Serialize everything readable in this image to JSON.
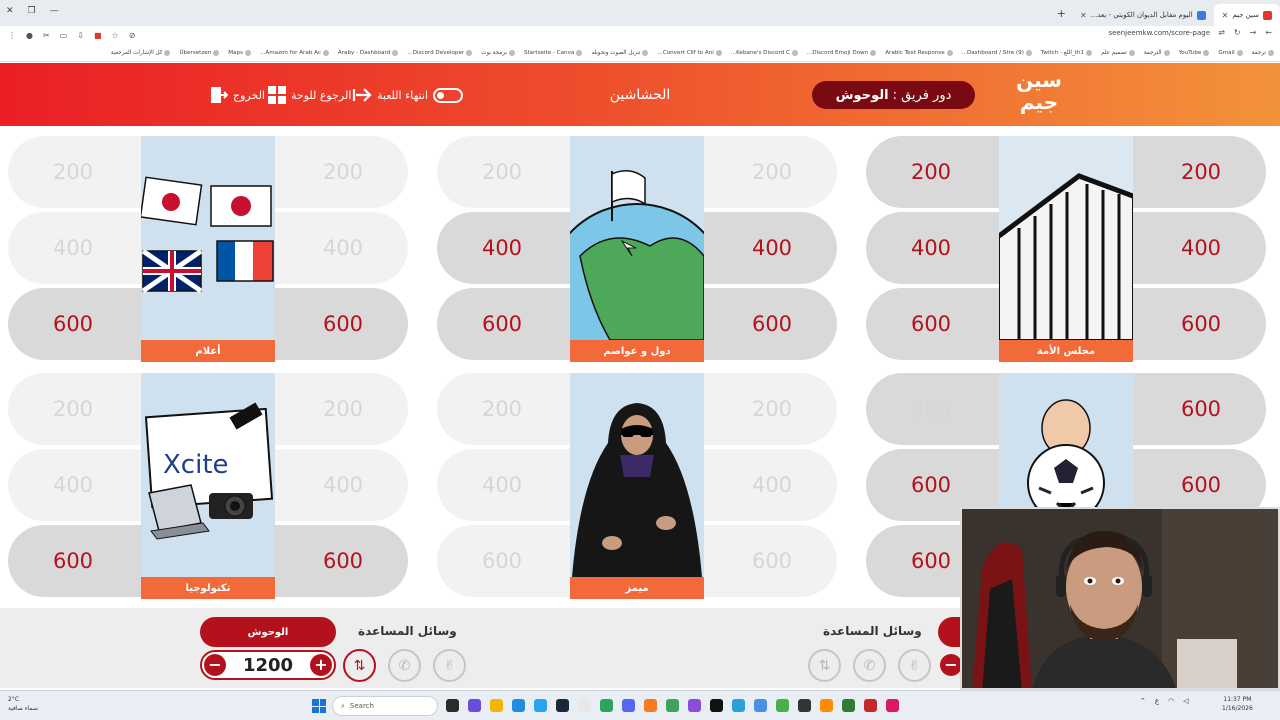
{
  "browser": {
    "tabs": [
      {
        "title": "سين جيم",
        "active": true
      },
      {
        "title": "اليوم مقابل الديوان الكويتي - بعد...",
        "active": false
      }
    ],
    "url": "seenjeemkw.com/score-page",
    "bookmarks": [
      "ترجمة",
      "Gmail",
      "YouTube",
      "الترجمة",
      "تصميم علم",
      "th1_اللغ - Twitch",
      "(9) Dashboard / Stre...",
      "Arabic Text Response",
      "Discord Emoji Down...",
      "Kebane's Discord C...",
      "Convert Clif to Ani...",
      "تنزيل الصوت وتحويله",
      "Startseite - Canva",
      "برمجة بوت",
      "Discord Developer...",
      "Araby - Dashboard",
      "Amazon for Arab Ac...",
      "Maps",
      "Übersetzen",
      "كل الإشارات المرجعية"
    ]
  },
  "header": {
    "logo_line1": "سين",
    "logo_line2": "جيم",
    "turn_prefix": "دور فريق :",
    "turn_team": "الوحوش",
    "game_name": "الحشاشين",
    "end_game": "انتهاء اللعبة",
    "back_to_board": "الرجوع للوحة",
    "exit": "الخروج"
  },
  "board": {
    "panels": [
      {
        "category": "مجلس الأمة",
        "art": "building",
        "left": [
          {
            "value": "200",
            "active": true
          },
          {
            "value": "400",
            "active": true
          },
          {
            "value": "600",
            "active": true
          }
        ],
        "right": [
          {
            "value": "200",
            "active": true
          },
          {
            "value": "400",
            "active": true
          },
          {
            "value": "600",
            "active": true
          }
        ]
      },
      {
        "category": "دول و عواصم",
        "art": "globe",
        "left": [
          {
            "value": "200",
            "active": false
          },
          {
            "value": "400",
            "active": true
          },
          {
            "value": "600",
            "active": true
          }
        ],
        "right": [
          {
            "value": "200",
            "active": false
          },
          {
            "value": "400",
            "active": true
          },
          {
            "value": "600",
            "active": true
          }
        ]
      },
      {
        "category": "أعلام",
        "art": "flags",
        "left": [
          {
            "value": "200",
            "active": false
          },
          {
            "value": "400",
            "active": false
          },
          {
            "value": "600",
            "active": true
          }
        ],
        "right": [
          {
            "value": "200",
            "active": false
          },
          {
            "value": "400",
            "active": false
          },
          {
            "value": "600",
            "active": true
          }
        ]
      },
      {
        "category": "",
        "art": "football",
        "left": [
          {
            "value": "600",
            "active": false
          },
          {
            "value": "600",
            "active": true
          },
          {
            "value": "600",
            "active": true
          }
        ],
        "right": [
          {
            "value": "600",
            "active": true
          },
          {
            "value": "600",
            "active": true
          },
          {
            "value": "600",
            "active": true
          }
        ]
      },
      {
        "category": "ميمز",
        "art": "abaya",
        "left": [
          {
            "value": "200",
            "active": false
          },
          {
            "value": "400",
            "active": false
          },
          {
            "value": "600",
            "active": false
          }
        ],
        "right": [
          {
            "value": "200",
            "active": false
          },
          {
            "value": "400",
            "active": false
          },
          {
            "value": "600",
            "active": false
          }
        ]
      },
      {
        "category": "تكنولوجيا",
        "art": "xcite",
        "brand_text": "Xcite",
        "left": [
          {
            "value": "200",
            "active": false
          },
          {
            "value": "400",
            "active": false
          },
          {
            "value": "600",
            "active": true
          }
        ],
        "right": [
          {
            "value": "200",
            "active": false
          },
          {
            "value": "400",
            "active": false
          },
          {
            "value": "600",
            "active": true
          }
        ]
      }
    ]
  },
  "teams": {
    "left": {
      "name": "الوحوش",
      "aids_label": "وسائل المساعدة",
      "score": "1200",
      "minus": "−",
      "plus": "+"
    },
    "right": {
      "aids_label": "وسائل المساعدة",
      "minus": "−"
    }
  },
  "taskbar": {
    "weather_temp": "2°C",
    "weather_desc": "سماء صافية",
    "search": "Search",
    "time": "11:37 PM",
    "date": "1/16/2026"
  },
  "colors": {
    "accent": "#b3121d",
    "header_start": "#ea1f26",
    "header_end": "#f3923a",
    "card_label": "#f26a3a"
  }
}
